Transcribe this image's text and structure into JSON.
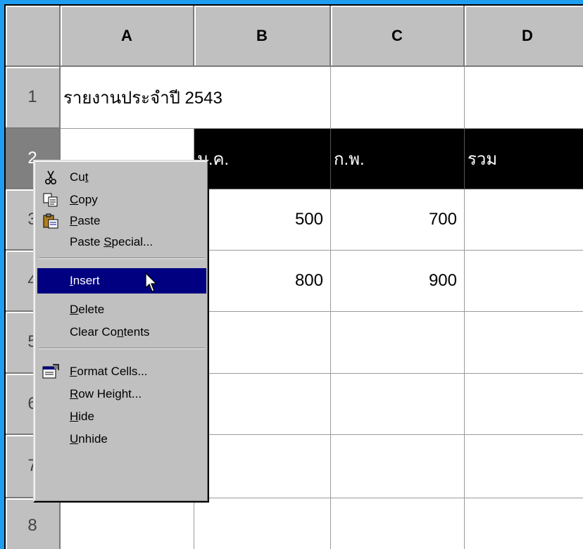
{
  "columns": [
    "A",
    "B",
    "C",
    "D"
  ],
  "rows": [
    "1",
    "2",
    "3",
    "4",
    "5",
    "6",
    "7",
    "8"
  ],
  "cells": {
    "a1": "รายงานประจำปี 2543",
    "b2": "ม.ค.",
    "c2": "ก.พ.",
    "d2": "รวม",
    "b3": "500",
    "c3": "700",
    "b4": "800",
    "c4": "900"
  },
  "context_menu": {
    "items": [
      {
        "pre": "Cu",
        "u": "t",
        "post": "",
        "icon": "cut-icon"
      },
      {
        "pre": "",
        "u": "C",
        "post": "opy",
        "icon": "copy-icon"
      },
      {
        "pre": "",
        "u": "P",
        "post": "aste",
        "icon": "paste-icon"
      },
      {
        "pre": "Paste ",
        "u": "S",
        "post": "pecial...",
        "icon": ""
      },
      {
        "pre": "",
        "u": "I",
        "post": "nsert",
        "icon": "",
        "highlighted": true
      },
      {
        "pre": "",
        "u": "D",
        "post": "elete",
        "icon": ""
      },
      {
        "pre": "Clear Co",
        "u": "n",
        "post": "tents",
        "icon": ""
      },
      {
        "pre": "",
        "u": "F",
        "post": "ormat Cells...",
        "icon": "format-cells-icon"
      },
      {
        "pre": "",
        "u": "R",
        "post": "ow Height...",
        "icon": ""
      },
      {
        "pre": "",
        "u": "H",
        "post": "ide",
        "icon": ""
      },
      {
        "pre": "",
        "u": "U",
        "post": "nhide",
        "icon": ""
      }
    ]
  },
  "colors": {
    "background": "#1f9df0",
    "header": "#c0c0c0",
    "selection": "#000000",
    "menu_highlight": "#000080"
  }
}
